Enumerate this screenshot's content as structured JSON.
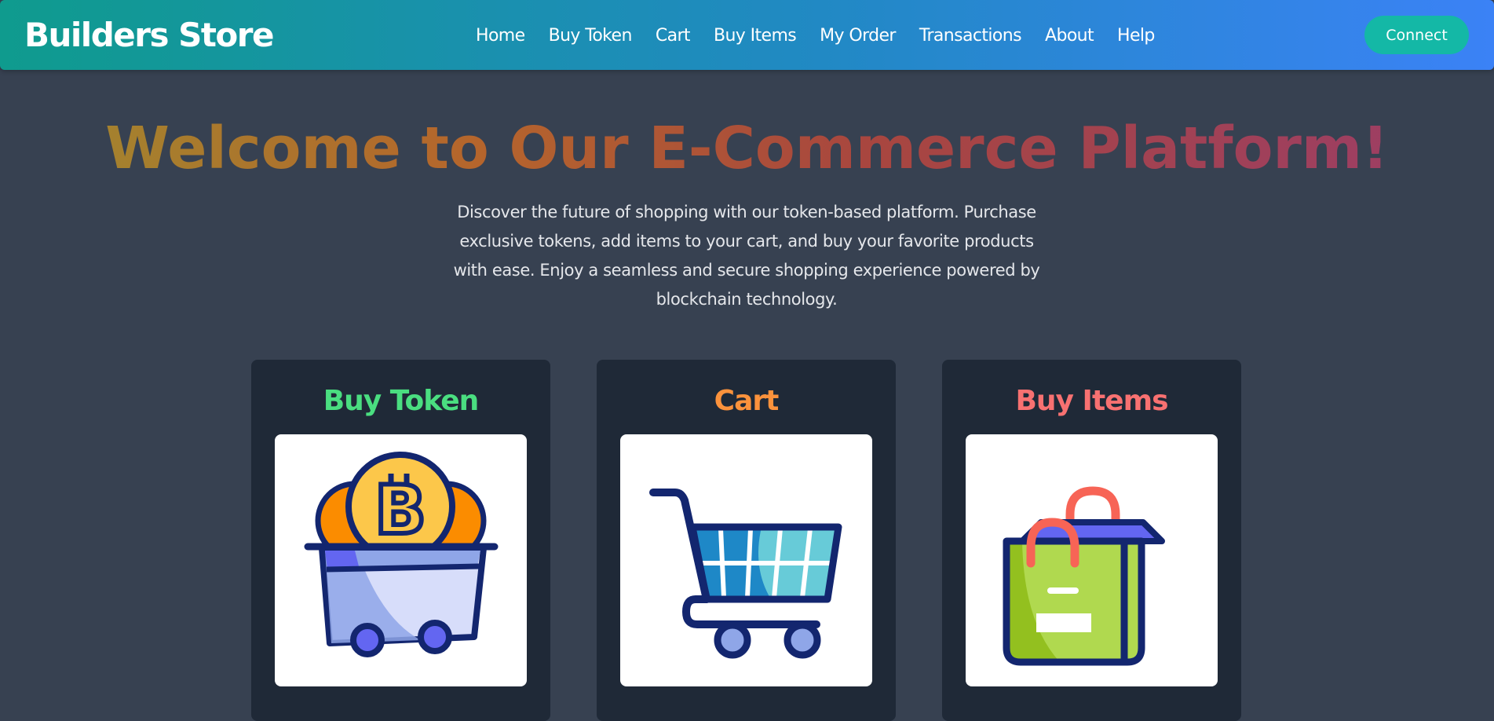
{
  "header": {
    "brand": "Builders Store",
    "nav": [
      "Home",
      "Buy Token",
      "Cart",
      "Buy Items",
      "My Order",
      "Transactions",
      "About",
      "Help"
    ],
    "connect_label": "Connect"
  },
  "hero": {
    "title": "Welcome to Our E-Commerce Platform!",
    "description": "Discover the future of shopping with our token-based platform. Purchase exclusive tokens, add items to your cart, and buy your favorite products with ease. Enjoy a seamless and secure shopping experience powered by blockchain technology."
  },
  "cards": [
    {
      "title": "Buy Token",
      "color": "#4ade80",
      "icon": "bitcoin-cart-icon"
    },
    {
      "title": "Cart",
      "color": "#fb923c",
      "icon": "shopping-cart-icon"
    },
    {
      "title": "Buy Items",
      "color": "#f87171",
      "icon": "shopping-bag-icon"
    }
  ],
  "colors": {
    "background": "#374151",
    "card_background": "#1f2937",
    "connect_button": "#14b8a6",
    "navbar_gradient_start": "#0f9b8e",
    "navbar_gradient_end": "#3b82f6"
  }
}
